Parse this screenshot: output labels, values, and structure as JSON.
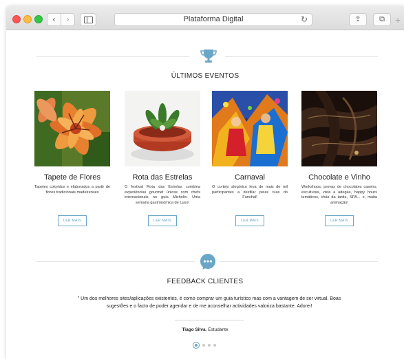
{
  "browser": {
    "address": "Plataforma Digital",
    "back_glyph": "‹",
    "forward_glyph": "›",
    "reload_glyph": "↻",
    "share_glyph": "⇪",
    "tabs_glyph": "⧉",
    "newtab_glyph": "+"
  },
  "events_section": {
    "title": "ÚLTIMOS EVENTOS",
    "icon": "trophy-icon",
    "items": [
      {
        "name": "Tapete de Flores",
        "description": "Tapetes coloridos e elaborados a partir de flores tradicionais madeirenses",
        "button": "LER MAIS"
      },
      {
        "name": "Rota das Estrelas",
        "description": "O festival Rota das Estrelas combina experiências gourmet únicas com chefs internacionais no guia Michelin. Uma semana gastronómica de Luxo!",
        "button": "LER MAIS"
      },
      {
        "name": "Carnaval",
        "description": "O cortejo alegórico leva de mais de mil participantes a desfilar pelas ruas do Funchal!",
        "button": "LER MAIS"
      },
      {
        "name": "Chocolate e Vinho",
        "description": "Workshops, provas de chocolates caseiro, esculturas, vista a adegas, happy hours temáticos, chás da tarde, SPA... e, muita animação!",
        "button": "LER MAIS"
      }
    ]
  },
  "feedback_section": {
    "title": "FEEDBACK CLIENTES",
    "icon": "speech-bubble-icon",
    "quote": "\" Um dos melhores sites/aplicações existentes, é como comprar um guia turístico mas com a vantagem de ser virtual. Boas sugestões e o facto de poder agendar e de me aconselhar actividades valoriza bastante. Adorei!",
    "author_name": "Tiago Silva",
    "author_role": ", Estudante",
    "pagination": {
      "total": 4,
      "active": 1
    }
  },
  "colors": {
    "accent": "#6aa6c7"
  }
}
